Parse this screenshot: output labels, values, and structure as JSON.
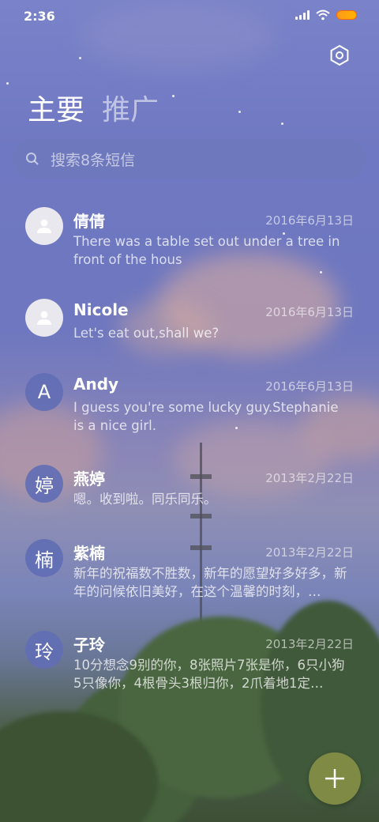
{
  "status_bar": {
    "time": "2:36",
    "battery_color": "#ff9a1a"
  },
  "header": {
    "settings_icon": "settings-hexagon-icon",
    "tabs": [
      {
        "label": "主要",
        "active": true
      },
      {
        "label": "推广",
        "active": false
      }
    ]
  },
  "search": {
    "placeholder": "搜索8条短信",
    "icon": "search-icon"
  },
  "conversations": [
    {
      "name": "倩倩",
      "date": "2016年6月13日",
      "preview": "There was a table set out under a tree in front of the hous",
      "avatar": "person-icon",
      "avatar_text": ""
    },
    {
      "name": "Nicole",
      "date": "2016年6月13日",
      "preview": "Let's eat out,shall we?",
      "avatar": "person-icon",
      "avatar_text": ""
    },
    {
      "name": "Andy",
      "date": "2016年6月13日",
      "preview": "I guess you're some lucky guy.Stephanie is a nice girl.",
      "avatar": "letter",
      "avatar_text": "A"
    },
    {
      "name": "燕婷",
      "date": "2013年2月22日",
      "preview": "嗯。收到啦。同乐同乐。",
      "avatar": "letter",
      "avatar_text": "婷"
    },
    {
      "name": "紫楠",
      "date": "2013年2月22日",
      "preview": "新年的祝福数不胜数，新年的愿望好多好多，新年的问候依旧美好，在这个温馨的时刻，…",
      "avatar": "letter",
      "avatar_text": "楠"
    },
    {
      "name": "子玲",
      "date": "2013年2月22日",
      "preview": "10分想念9别的你，8张照片7张是你，6只小狗5只像你，4根骨头3根归你，2爪着地1定…",
      "avatar": "letter",
      "avatar_text": "玲"
    }
  ],
  "fab": {
    "icon": "plus-icon",
    "color": "#7f8a45"
  }
}
